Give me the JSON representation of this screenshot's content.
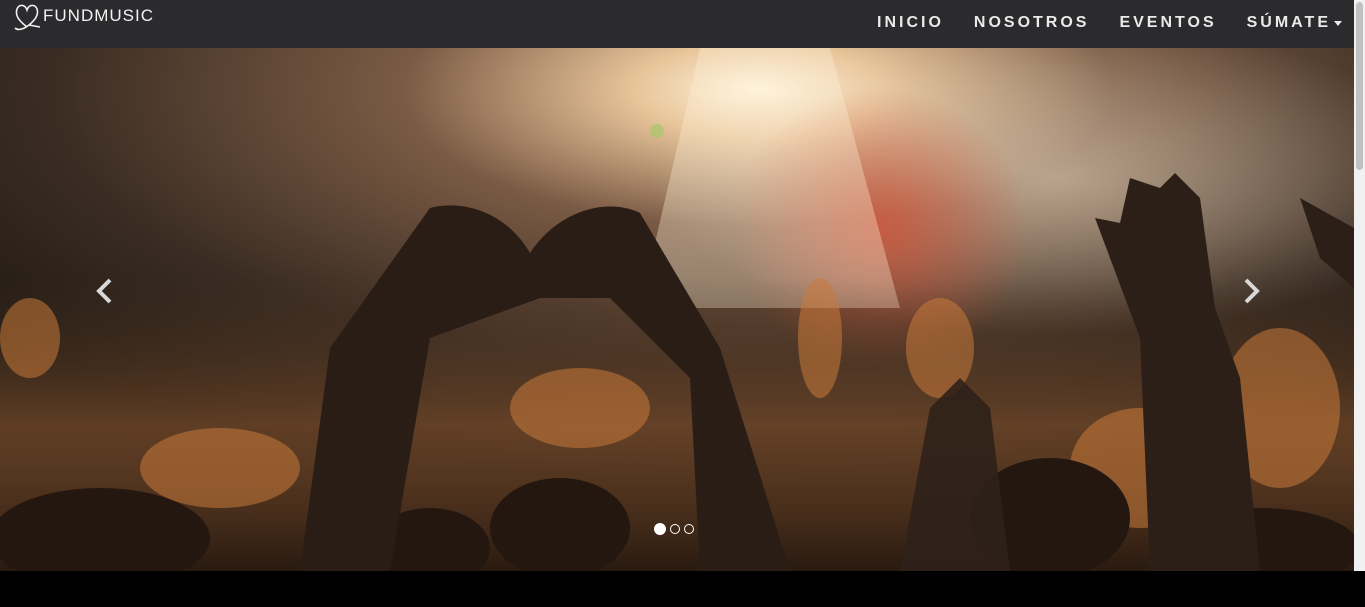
{
  "brand": {
    "name": "FUNDMUSIC",
    "logo_icon": "heart-note-icon"
  },
  "nav": {
    "items": [
      {
        "label": "INICIO"
      },
      {
        "label": "NOSOTROS"
      },
      {
        "label": "EVENTOS"
      },
      {
        "label": "SÚMATE",
        "dropdown": true
      }
    ]
  },
  "carousel": {
    "slide_count": 3,
    "active_index": 0,
    "prev_icon": "chevron-left-icon",
    "next_icon": "chevron-right-icon",
    "image_subject": "concert-crowd-heart-hands"
  },
  "colors": {
    "navbar_bg": "#2b2b2e",
    "nav_text": "#eaeaea",
    "page_bg": "#000000"
  }
}
